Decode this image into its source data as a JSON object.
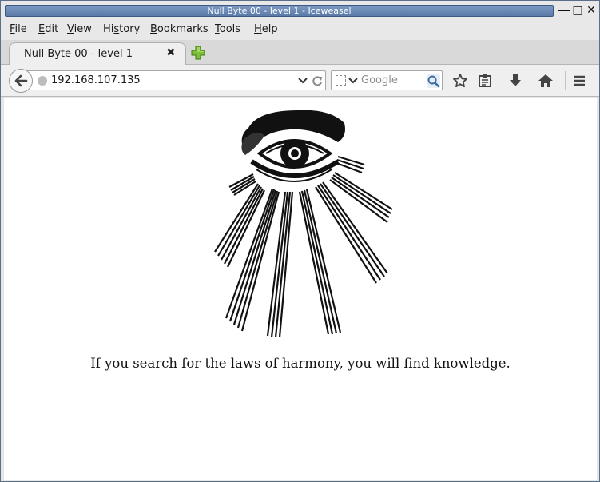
{
  "window": {
    "title": "Null Byte 00 - level 1 - Iceweasel",
    "controls": {
      "minimize": "―",
      "maximize": "□",
      "close": "✕"
    }
  },
  "menubar": {
    "items": [
      {
        "label": "File",
        "mnemonic": "F",
        "rest": "ile"
      },
      {
        "label": "Edit",
        "mnemonic": "E",
        "rest": "dit"
      },
      {
        "label": "View",
        "mnemonic": "V",
        "rest": "iew"
      },
      {
        "label": "History",
        "mnemonic": "s",
        "pre": "Hi",
        "rest": "tory"
      },
      {
        "label": "Bookmarks",
        "mnemonic": "B",
        "rest": "ookmarks"
      },
      {
        "label": "Tools",
        "mnemonic": "T",
        "rest": "ools"
      },
      {
        "label": "Help",
        "mnemonic": "H",
        "rest": "elp"
      }
    ]
  },
  "tabs": [
    {
      "label": "Null Byte 00 - level 1",
      "close": "✖"
    }
  ],
  "navbar": {
    "url": "192.168.107.135",
    "search_placeholder": "Google",
    "icons": [
      "back-icon",
      "globe-icon",
      "dropdown-icon",
      "reload-icon",
      "search-engine-icon",
      "search-icon",
      "bookmark-star-icon",
      "reading-list-icon",
      "download-icon",
      "home-icon",
      "menu-icon"
    ]
  },
  "content": {
    "image": "all-seeing-eye-with-rays",
    "quote": "If you search for the laws of harmony, you will find knowledge."
  },
  "colors": {
    "titlebar_accent": "#6b88b6",
    "content_bg": "#ffffff",
    "chrome_bg": "#e8e8e8"
  }
}
